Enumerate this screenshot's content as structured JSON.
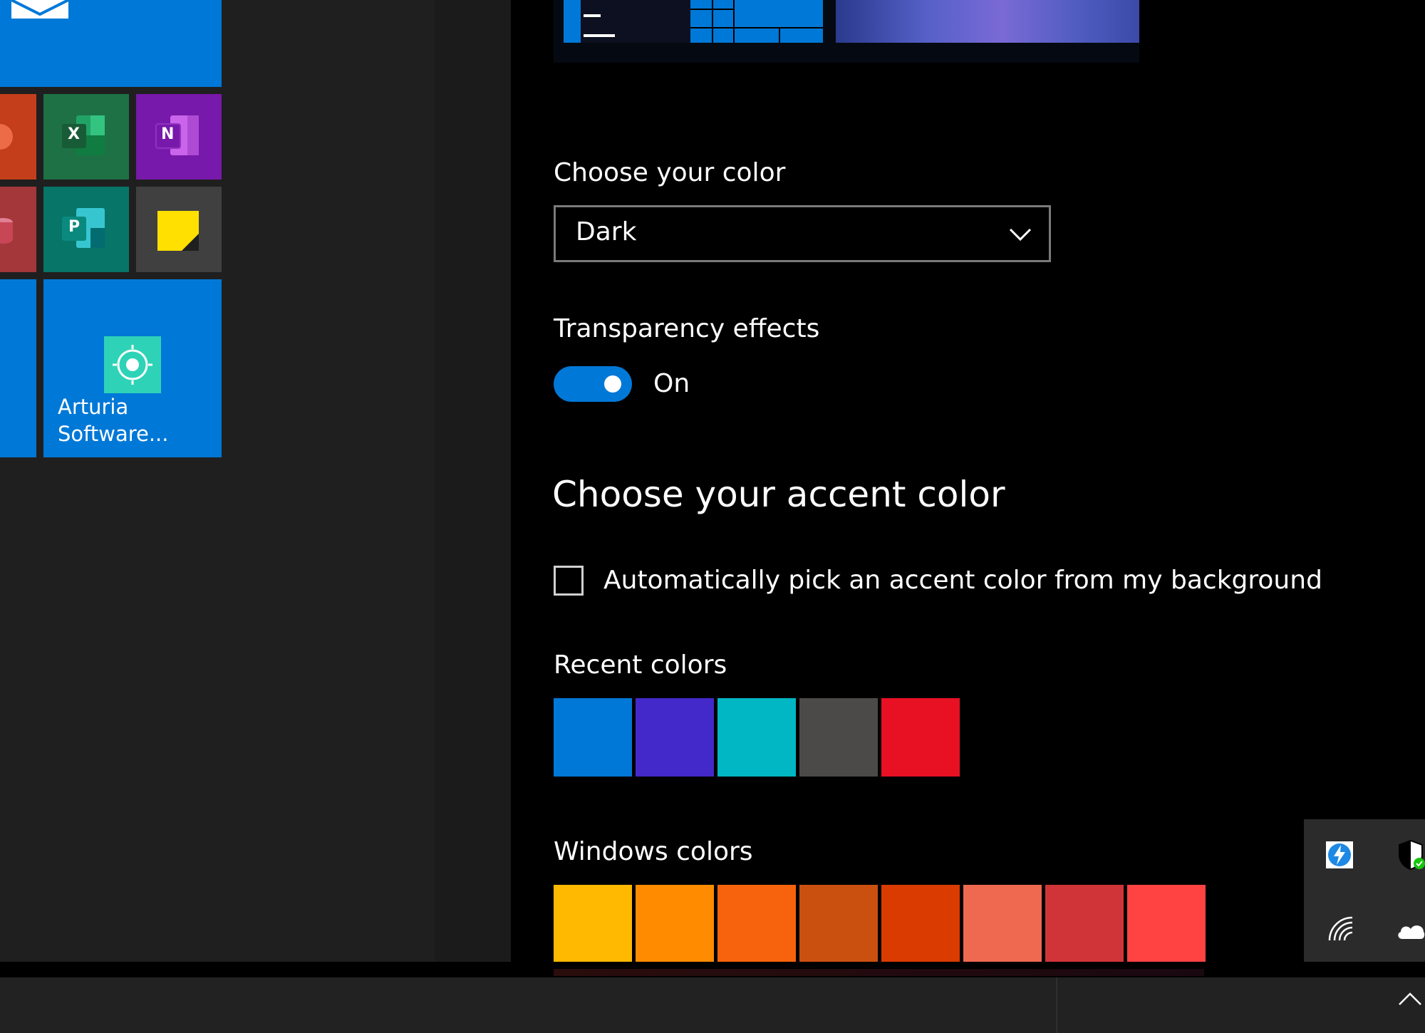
{
  "start_menu": {
    "tiles": {
      "arturia_label": "Arturia Software...",
      "excel_glyph": "X",
      "onenote_glyph": "N",
      "publisher_glyph": "P"
    },
    "colors": {
      "blue": "#0078d7",
      "excel": "#1e7145",
      "onenote": "#7719aa",
      "publisher": "#077568",
      "sticky": "#404040",
      "powerpoint": "#c43e1c",
      "access": "#a4373a"
    }
  },
  "settings": {
    "choose_color_label": "Choose your color",
    "color_mode_value": "Dark",
    "transparency_label": "Transparency effects",
    "transparency_state": "On",
    "accent_heading": "Choose your accent color",
    "auto_accent_label": "Automatically pick an accent color from my background",
    "auto_accent_checked": false,
    "recent_colors_label": "Recent colors",
    "recent_colors": [
      "#0078d7",
      "#4329c9",
      "#00b7c3",
      "#4c4a48",
      "#e81123"
    ],
    "windows_colors_label": "Windows colors",
    "windows_colors": [
      "#ffb900",
      "#ff8c00",
      "#f7630c",
      "#ca5010",
      "#da3b01",
      "#ef6950",
      "#d13438",
      "#ff4343"
    ],
    "accent_color": "#0078d7"
  },
  "tray": {
    "icons": [
      "thunderbolt-icon",
      "security-shield-icon",
      "wifi-icon",
      "onedrive-cloud-icon"
    ]
  },
  "taskbar": {
    "icons": [
      "show-hidden-icons-chevron-icon"
    ]
  }
}
